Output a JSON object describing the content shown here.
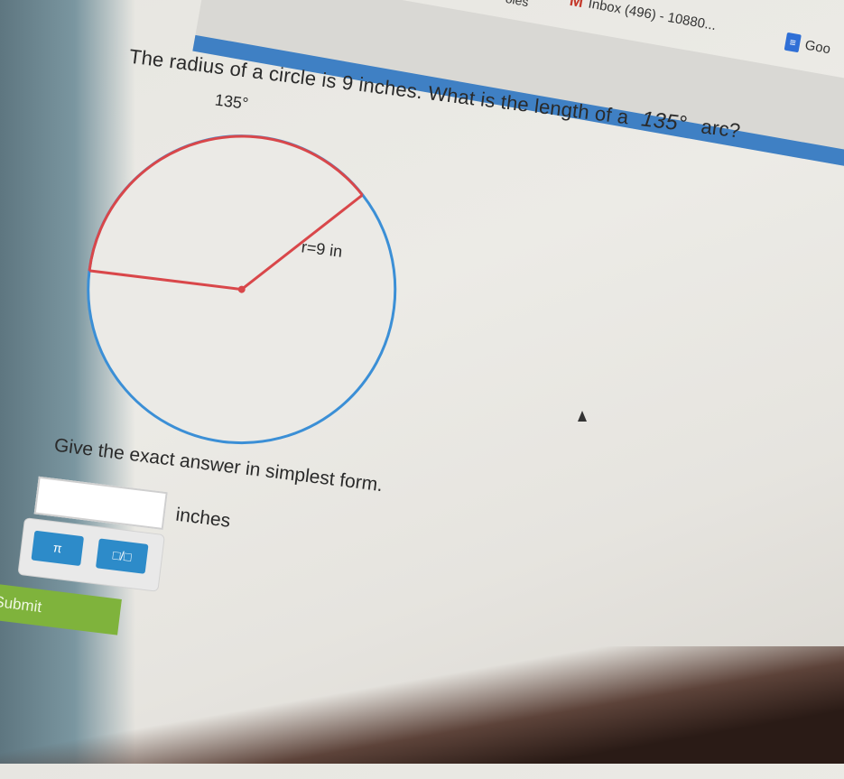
{
  "browser": {
    "prev_tab_label": "oles",
    "gmail_tab_label": "Inbox (496) - 10880...",
    "docs_tab_label": "Goo",
    "accent_color": "#3f80c4"
  },
  "question": {
    "text": "The radius of a circle is 9 inches. What is the length of a",
    "angle": "135°",
    "tail": "arc?"
  },
  "figure": {
    "angle_label": "135°",
    "radius_label": "r=9 in",
    "arc_color": "#d9474a",
    "circle_color": "#3b8fd6"
  },
  "answer": {
    "instruction": "Give the exact answer in simplest form.",
    "input_value": "",
    "units_label": "inches",
    "pi_button_label": "π",
    "fraction_button_label": "□/□",
    "submit_label": "Submit"
  }
}
